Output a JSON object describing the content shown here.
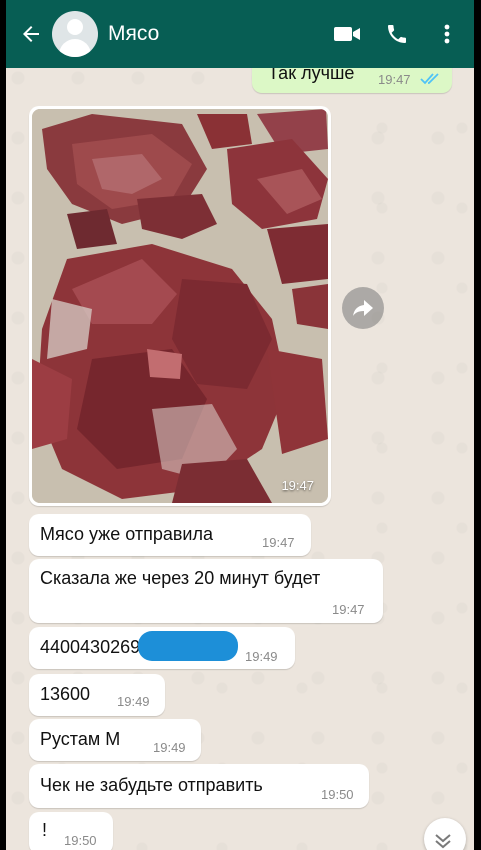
{
  "header": {
    "title": "Мясо",
    "bg_color": "#075e54",
    "icons": [
      "arrow-left-icon",
      "video-call-icon",
      "phone-icon",
      "more-vert-icon"
    ]
  },
  "messages": [
    {
      "id": "m0",
      "direction": "out",
      "text": "Так лучше",
      "time": "19:47",
      "status": "read"
    },
    {
      "id": "m1",
      "direction": "in",
      "type": "photo",
      "caption": "",
      "time": "19:47"
    },
    {
      "id": "m2",
      "direction": "in",
      "text": "Мясо уже отправила",
      "time": "19:47"
    },
    {
      "id": "m3",
      "direction": "in",
      "text": "Сказала же через 20 минут будет",
      "time": "19:47"
    },
    {
      "id": "m4",
      "direction": "in",
      "text": "4400430269",
      "time": "19:49",
      "redacted": true
    },
    {
      "id": "m5",
      "direction": "in",
      "text": "13600",
      "time": "19:49"
    },
    {
      "id": "m6",
      "direction": "in",
      "text": "Рустам М",
      "time": "19:49"
    },
    {
      "id": "m7",
      "direction": "in",
      "text": "Чек не забудьте отправить",
      "time": "19:50"
    },
    {
      "id": "m8",
      "direction": "in",
      "text": "!",
      "time": "19:50"
    }
  ],
  "colors": {
    "chat_background": "#ece5dd",
    "incoming_bubble": "#ffffff",
    "outgoing_bubble": "#dcf8c6",
    "read_ticks": "#4fc3f7",
    "redaction": "#1d8fd8"
  }
}
